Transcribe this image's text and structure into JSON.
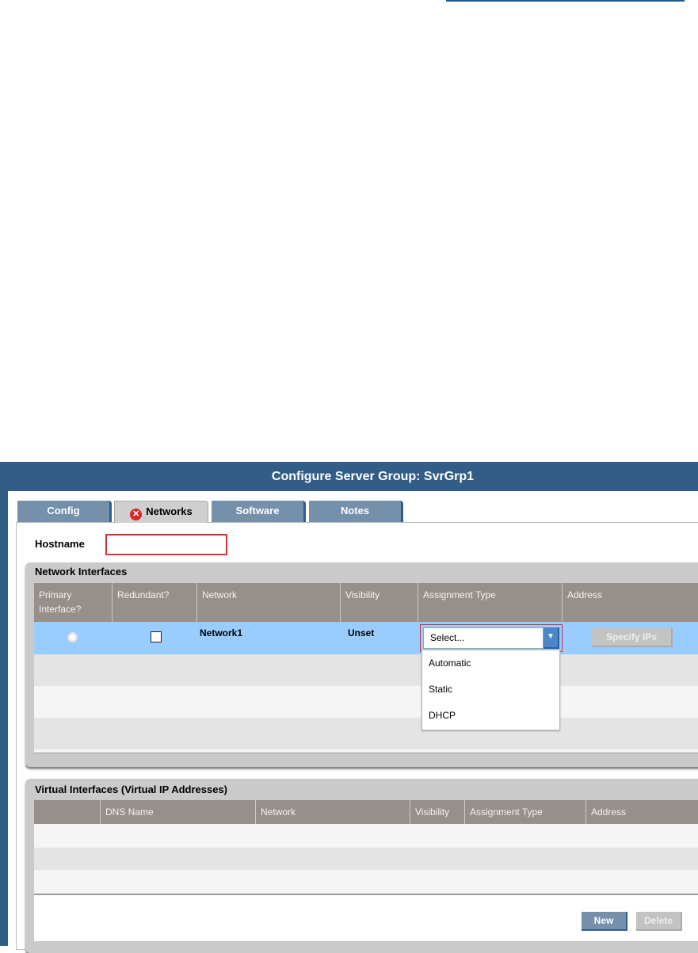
{
  "header": {
    "title": "Configure Server Group: SvrGrp1"
  },
  "tabs": [
    {
      "label": "Config"
    },
    {
      "label": "Networks",
      "status_icon": "error-icon"
    },
    {
      "label": "Software"
    },
    {
      "label": "Notes"
    }
  ],
  "hostname": {
    "label": "Hostname",
    "value": ""
  },
  "network_interfaces": {
    "title": "Network Interfaces",
    "columns": [
      "Primary Interface?",
      "Redundant?",
      "Network",
      "Visibility",
      "Assignment Type",
      "Address"
    ],
    "rows": [
      {
        "primary": true,
        "redundant": false,
        "network": "Network1",
        "visibility": "Unset",
        "assignment_type": "Select...",
        "address_button": "Specify IPs"
      }
    ],
    "assignment_options": [
      "Automatic",
      "Static",
      "DHCP"
    ]
  },
  "virtual_interfaces": {
    "title": "Virtual Interfaces (Virtual IP Addresses)",
    "columns": [
      "",
      "DNS Name",
      "Network",
      "Visibility",
      "Assignment Type",
      "Address"
    ],
    "rows": [],
    "buttons": {
      "new": "New",
      "delete": "Delete"
    }
  },
  "colors": {
    "header": "#325d87",
    "selected_row": "#99ccff",
    "error": "#d0303a"
  }
}
